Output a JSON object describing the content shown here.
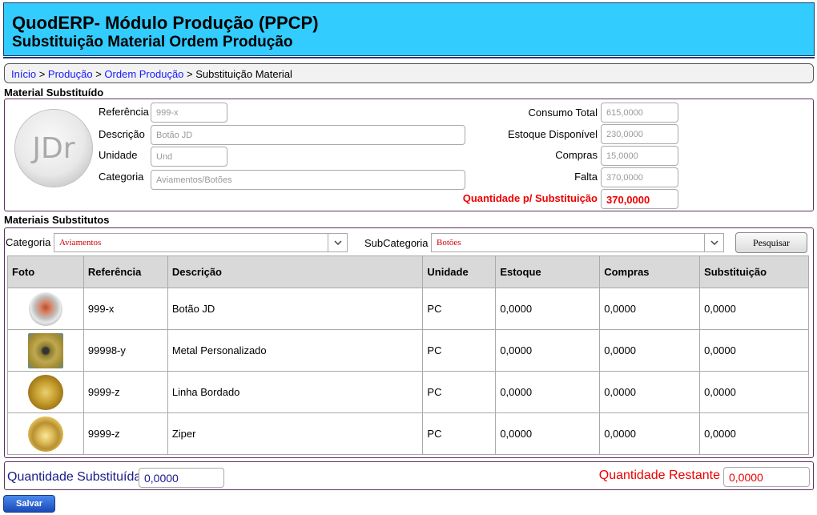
{
  "header": {
    "title": "QuodERP- Módulo Produção (PPCP)",
    "subtitle": "Substituição Material Ordem Produção"
  },
  "breadcrumb": {
    "items": [
      "Início",
      "Produção",
      "Ordem Produção"
    ],
    "current": "Substituição Material",
    "separator": ">"
  },
  "material_substituido": {
    "section_title": "Material Substituído",
    "logo_text": "JDr",
    "referencia_label": "Referência",
    "referencia_value": "999-x",
    "descricao_label": "Descrição",
    "descricao_value": "Botão JD",
    "unidade_label": "Unidade",
    "unidade_value": "Und",
    "categoria_label": "Categoria",
    "categoria_value": "Aviamentos/Botões",
    "consumo_total_label": "Consumo Total",
    "consumo_total_value": "615,0000",
    "estoque_label": "Estoque Disponível",
    "estoque_value": "230,0000",
    "compras_label": "Compras",
    "compras_value": "15,0000",
    "falta_label": "Falta",
    "falta_value": "370,0000",
    "qtd_substituicao_label": "Quantidade p/ Substituição",
    "qtd_substituicao_value": "370,0000"
  },
  "materiais_substitutos": {
    "section_title": "Materiais Substitutos",
    "categoria_label": "Categoria",
    "categoria_value": "Aviamentos",
    "subcategoria_label": "SubCategoria",
    "subcategoria_value": "Botões",
    "search_button": "Pesquisar",
    "columns": [
      "Foto",
      "Referência",
      "Descrição",
      "Unidade",
      "Estoque",
      "Compras",
      "Substituição"
    ],
    "rows": [
      {
        "photo": "button-copper-icon",
        "referencia": "999-x",
        "descricao": "Botão JD",
        "unidade": "PC",
        "estoque": "0,0000",
        "compras": "0,0000",
        "substituicao": "0,0000"
      },
      {
        "photo": "button-metal-icon",
        "referencia": "99998-y",
        "descricao": "Metal Personalizado",
        "unidade": "PC",
        "estoque": "0,0000",
        "compras": "0,0000",
        "substituicao": "0,0000"
      },
      {
        "photo": "button-gold-jdr-icon",
        "referencia": "9999-z",
        "descricao": "Linha Bordado",
        "unidade": "PC",
        "estoque": "0,0000",
        "compras": "0,0000",
        "substituicao": "0,0000"
      },
      {
        "photo": "button-gold-icon",
        "referencia": "9999-z",
        "descricao": "Ziper",
        "unidade": "PC",
        "estoque": "0,0000",
        "compras": "0,0000",
        "substituicao": "0,0000"
      }
    ]
  },
  "totals": {
    "qtd_substituida_label": "Quantidade Substituída",
    "qtd_substituida_value": "0,0000",
    "qtd_restante_label": "Quantidade Restante",
    "qtd_restante_value": "0,0000"
  },
  "save_button": "Salvar",
  "colors": {
    "header_bg": "#33ccff",
    "link": "#1a1aff",
    "alert_red": "#e00000",
    "navy": "#1a1a88"
  }
}
